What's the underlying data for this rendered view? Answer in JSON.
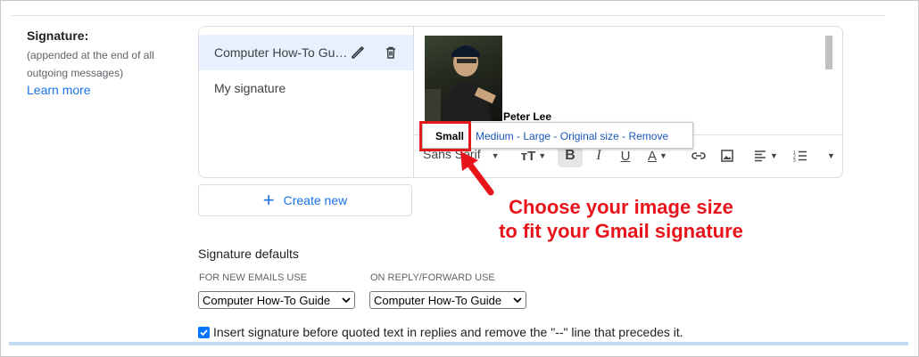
{
  "signature_section": {
    "label": "Signature:",
    "description": "(appended at the end of all outgoing messages)",
    "learn_more": "Learn more"
  },
  "signatures": [
    {
      "name": "Computer How-To Guide",
      "selected": true
    },
    {
      "name": "My signature",
      "selected": false
    }
  ],
  "editor": {
    "signature_name_text": "Peter Lee",
    "font": "Sans Serif",
    "image_size_options": {
      "small": "Small",
      "others": [
        "Medium",
        "Large",
        "Original size",
        "Remove"
      ],
      "separator": " - "
    }
  },
  "annotation": {
    "line1": "Choose your image size",
    "line2": "to fit your Gmail signature",
    "color": "#e8141b"
  },
  "create_new_label": "Create new",
  "defaults": {
    "title": "Signature defaults",
    "new_emails_label": "FOR NEW EMAILS USE",
    "new_emails_value": "Computer How-To Guide",
    "reply_label": "ON REPLY/FORWARD USE",
    "reply_value": "Computer How-To Guide"
  },
  "insert_before_quoted": {
    "checked": true,
    "label": "Insert signature before quoted text in replies and remove the \"--\" line that precedes it."
  },
  "colors": {
    "accent": "#1a73e8",
    "selected_bg": "#e8f0fe",
    "highlight": "#e01b1b"
  }
}
